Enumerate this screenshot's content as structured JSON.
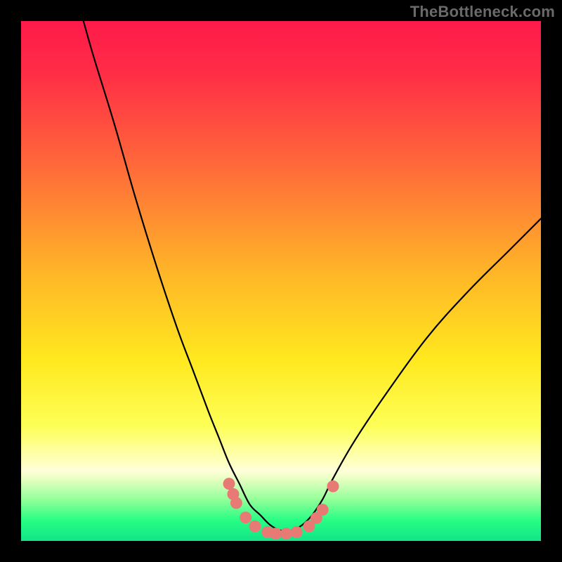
{
  "watermark": "TheBottleneck.com",
  "chart_data": {
    "type": "line",
    "title": "",
    "xlabel": "",
    "ylabel": "",
    "xlim": [
      0,
      100
    ],
    "ylim": [
      0,
      100
    ],
    "legend": "off",
    "grid": "off",
    "background_gradient": {
      "stops": [
        {
          "pct": 0,
          "color": "#ff1a4a"
        },
        {
          "pct": 10,
          "color": "#ff2d46"
        },
        {
          "pct": 28,
          "color": "#ff6a3a"
        },
        {
          "pct": 48,
          "color": "#ffb428"
        },
        {
          "pct": 65,
          "color": "#ffe81e"
        },
        {
          "pct": 78,
          "color": "#fdff57"
        },
        {
          "pct": 86.5,
          "color": "#feffd9"
        },
        {
          "pct": 88,
          "color": "#e9ffc3"
        },
        {
          "pct": 92,
          "color": "#93ff99"
        },
        {
          "pct": 96,
          "color": "#28fd84"
        },
        {
          "pct": 100,
          "color": "#11e587"
        }
      ]
    },
    "series": [
      {
        "name": "bottleneck-curve",
        "x": [
          12,
          14,
          18,
          22,
          26,
          30,
          33,
          36,
          38,
          40,
          42,
          44,
          46,
          48,
          50,
          52,
          54,
          56,
          58,
          60,
          64,
          70,
          78,
          86,
          94,
          100
        ],
        "y": [
          100,
          93,
          80,
          66,
          53,
          41,
          33,
          25,
          20,
          15,
          11,
          7,
          5,
          3,
          2,
          2,
          3,
          5,
          8,
          12,
          19,
          28,
          39,
          48,
          56,
          62
        ]
      }
    ],
    "markers": {
      "name": "near-bottom-dots",
      "points": [
        {
          "x": 40.0,
          "y": 11.0
        },
        {
          "x": 40.8,
          "y": 9.0
        },
        {
          "x": 41.4,
          "y": 7.3
        },
        {
          "x": 43.2,
          "y": 4.5
        },
        {
          "x": 45.0,
          "y": 2.8
        },
        {
          "x": 47.4,
          "y": 1.7
        },
        {
          "x": 49.0,
          "y": 1.4
        },
        {
          "x": 51.0,
          "y": 1.4
        },
        {
          "x": 53.0,
          "y": 1.7
        },
        {
          "x": 55.4,
          "y": 2.8
        },
        {
          "x": 56.8,
          "y": 4.4
        },
        {
          "x": 58.0,
          "y": 6.0
        },
        {
          "x": 60.0,
          "y": 10.5
        }
      ]
    }
  }
}
